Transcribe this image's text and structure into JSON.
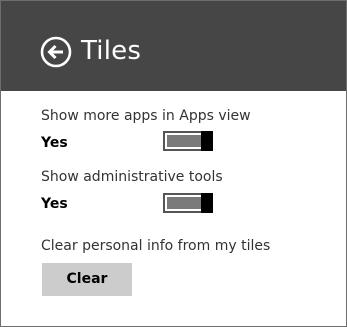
{
  "header": {
    "title": "Tiles",
    "back_icon": "back-arrow-circle-icon"
  },
  "settings": [
    {
      "label": "Show more apps in Apps view",
      "value": "Yes",
      "state": "on"
    },
    {
      "label": "Show administrative tools",
      "value": "Yes",
      "state": "on"
    }
  ],
  "clear_section": {
    "label": "Clear personal info from my tiles",
    "button_label": "Clear"
  },
  "colors": {
    "header_bg": "#464646",
    "header_text": "#ffffff",
    "button_bg": "#cccccc",
    "toggle_track": "#7a7a7a",
    "toggle_thumb": "#000000"
  }
}
